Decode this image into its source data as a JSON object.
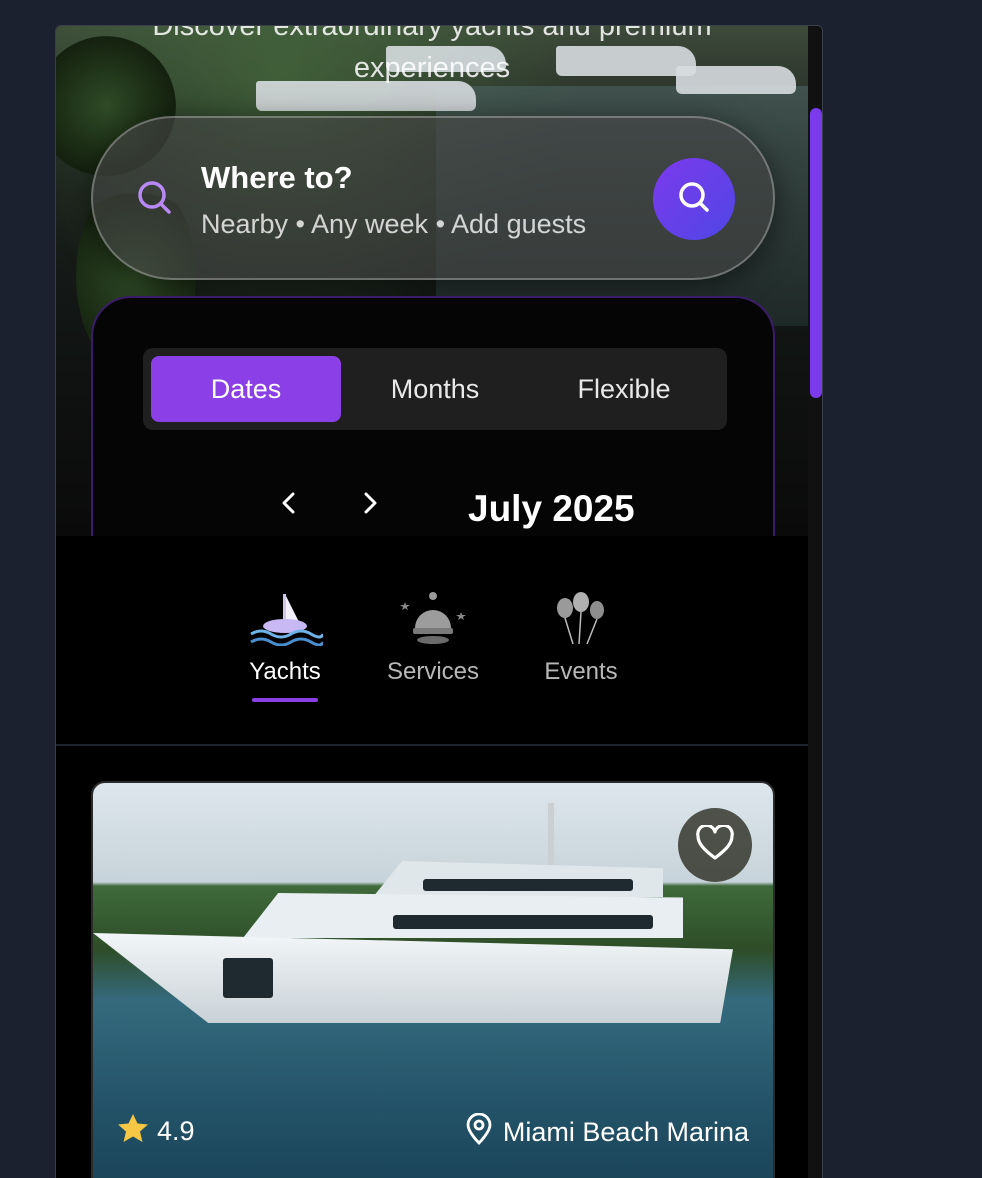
{
  "hero": {
    "tagline_line1": "Discover extraordinary yachts and premium",
    "tagline_line2": "experiences"
  },
  "search": {
    "title": "Where to?",
    "subtitle": "Nearby • Any week • Add guests",
    "search_icon": "search-icon",
    "button_icon": "search-icon"
  },
  "calendar": {
    "modes": [
      "Dates",
      "Months",
      "Flexible"
    ],
    "active_mode": "Dates",
    "prev_label": "‹",
    "next_label": "›",
    "month": "July 2025"
  },
  "categories": {
    "items": [
      {
        "label": "Yachts",
        "icon": "sailboat-icon",
        "active": true
      },
      {
        "label": "Services",
        "icon": "service-bell-icon",
        "active": false
      },
      {
        "label": "Events",
        "icon": "balloons-icon",
        "active": false
      }
    ]
  },
  "listing": {
    "rating": "4.9",
    "location": "Miami Beach Marina",
    "favorite_icon": "heart-icon"
  },
  "colors": {
    "accent": "#8b3fe6",
    "background": "#1c2130",
    "panel": "#000000"
  }
}
